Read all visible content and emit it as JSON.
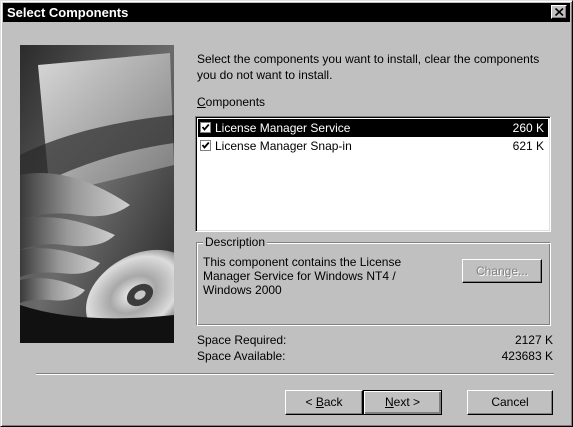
{
  "window": {
    "title": "Select Components",
    "close_icon": "close-icon"
  },
  "intro": {
    "text": "Select the components you want to install, clear the components you do not want to install."
  },
  "components": {
    "label_accel": "C",
    "label_rest": "omponents",
    "items": [
      {
        "name": "License Manager Service",
        "size": "260 K",
        "checked": true,
        "selected": true
      },
      {
        "name": "License Manager Snap-in",
        "size": "621 K",
        "checked": true,
        "selected": false
      }
    ]
  },
  "description": {
    "legend": "Description",
    "text": "This component contains the License Manager Service for Windows NT4 / Windows 2000",
    "change_label": "Change..."
  },
  "space": {
    "required_label": "Space Required:",
    "required_value": "2127 K",
    "available_label": "Space Available:",
    "available_value": "423683 K"
  },
  "buttons": {
    "back_prefix": "< ",
    "back_accel": "B",
    "back_rest": "ack",
    "next_accel": "N",
    "next_rest": "ext >",
    "cancel_label": "Cancel"
  }
}
